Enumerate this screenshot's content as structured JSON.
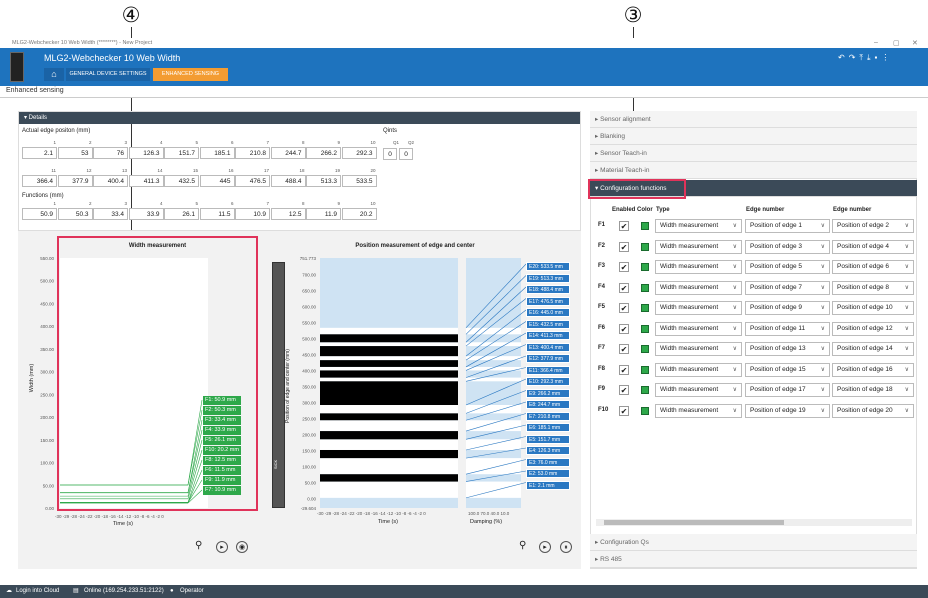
{
  "callouts": {
    "left": "④",
    "right": "③"
  },
  "window": {
    "title": "MLG2-Webchecker 10 Web Width (********) - New Project",
    "controls": [
      "–",
      "▢",
      "✕"
    ]
  },
  "app": {
    "title": "MLG2-Webchecker 10 Web Width",
    "tab_general": "GENERAL DEVICE SETTINGS",
    "tab_enhanced": "ENHANCED SENSING",
    "home_icon": "home-icon",
    "right_icons": [
      "undo-icon",
      "redo-icon",
      "upload-icon",
      "download-icon",
      "save-icon",
      "menu-icon"
    ]
  },
  "breadcrumb": "Enhanced sensing",
  "details": {
    "header": "▾ Details",
    "actual_label": "Actual edge positon (mm)",
    "row1_idx": [
      "1",
      "2",
      "3",
      "4",
      "5",
      "6",
      "7",
      "8",
      "9",
      "10"
    ],
    "row1": [
      "2.1",
      "53",
      "76",
      "126.3",
      "151.7",
      "185.1",
      "210.8",
      "244.7",
      "266.2",
      "292.3"
    ],
    "row2_idx": [
      "11",
      "12",
      "13",
      "14",
      "15",
      "16",
      "17",
      "18",
      "19",
      "20"
    ],
    "row2": [
      "366.4",
      "377.9",
      "400.4",
      "411.3",
      "432.5",
      "445",
      "476.5",
      "488.4",
      "513.3",
      "533.5"
    ],
    "qints_label": "Qints",
    "q_idx": [
      "Q1",
      "Q2"
    ],
    "q_vals": [
      "0",
      "0"
    ],
    "functions_label": "Functions (mm)",
    "func_idx": [
      "1",
      "2",
      "3",
      "4",
      "5",
      "6",
      "7",
      "8",
      "9",
      "10"
    ],
    "func_vals": [
      "50.9",
      "50.3",
      "33.4",
      "33.9",
      "26.1",
      "11.5",
      "10.9",
      "12.5",
      "11.9",
      "20.2"
    ]
  },
  "chart_width": {
    "title": "Width measurement",
    "ylabel": "Width (mm)",
    "xlabel": "Time (s)",
    "yticks": [
      "550.00",
      "500.00",
      "450.00",
      "400.00",
      "350.00",
      "300.00",
      "250.00",
      "200.00",
      "150.00",
      "100.00",
      "50.00",
      "0.00"
    ],
    "xticks": "-30 -29 -28 -24 -22 -20 -18 -16 -14 -12 -10 -8 -6 -4 -2 0",
    "labels": [
      "F1: 50.9 mm",
      "F2: 50.3 mm",
      "F3: 33.4 mm",
      "F4: 33.9 mm",
      "F5: 26.1 mm",
      "F10: 20.2 mm",
      "F8: 12.5 mm",
      "F6: 11.5 mm",
      "F9: 11.9 mm",
      "F7: 10.9 mm"
    ]
  },
  "chart_pos": {
    "title": "Position measurement of edge and center",
    "ylabel": "Position of edge and center (mm)",
    "xlabel": "Time (s)",
    "xlabel2": "Damping (%)",
    "yticks": [
      "751.773",
      "700.00",
      "650.00",
      "600.00",
      "550.00",
      "500.00",
      "450.00",
      "400.00",
      "350.00",
      "300.00",
      "250.00",
      "200.00",
      "150.00",
      "100.00",
      "50.00",
      "0.00",
      "-29.604"
    ],
    "xticks": "-30 -29 -28 -24 -22 -20 -18 -16 -14 -12 -10 -8 -6 -4 -2 0",
    "dticks": "100.0 70.0 40.0 10.0",
    "sensor_label": "SICK",
    "labels": [
      "E20: 533.5 mm",
      "E19: 513.3 mm",
      "E18: 488.4 mm",
      "E17: 476.5 mm",
      "E16: 445.0 mm",
      "E15: 432.5 mm",
      "E14: 411.3 mm",
      "E13: 400.4 mm",
      "E12: 377.9 mm",
      "E11: 366.4 mm",
      "E10: 292.3 mm",
      "E9: 266.2 mm",
      "E8: 244.7 mm",
      "E7: 210.8 mm",
      "E6: 185.1 mm",
      "E5: 151.7 mm",
      "E4: 126.3 mm",
      "E3: 76.0 mm",
      "E2: 53.0 mm",
      "E1: 2.1 mm"
    ]
  },
  "accordion": {
    "sensor_alignment": "▸ Sensor alignment",
    "blanking": "▸ Blanking",
    "sensor_teach": "▸ Sensor Teach-in",
    "material_teach": "▸ Material Teach-in",
    "config": "▾ Configuration functions",
    "config_qs": "▸ Configuration Qs",
    "rs485": "▸ RS 485"
  },
  "config": {
    "headers": {
      "enabled": "Enabled",
      "color": "Color",
      "type": "Type",
      "edge1": "Edge number",
      "edge2": "Edge number"
    },
    "rows": [
      {
        "id": "F1",
        "type": "Width measurement",
        "e1": "Position of edge 1",
        "e2": "Position of edge 2"
      },
      {
        "id": "F2",
        "type": "Width measurement",
        "e1": "Position of edge 3",
        "e2": "Position of edge 4"
      },
      {
        "id": "F3",
        "type": "Width measurement",
        "e1": "Position of edge 5",
        "e2": "Position of edge 6"
      },
      {
        "id": "F4",
        "type": "Width measurement",
        "e1": "Position of edge 7",
        "e2": "Position of edge 8"
      },
      {
        "id": "F5",
        "type": "Width measurement",
        "e1": "Position of edge 9",
        "e2": "Position of edge 10"
      },
      {
        "id": "F6",
        "type": "Width measurement",
        "e1": "Position of edge 11",
        "e2": "Position of edge 12"
      },
      {
        "id": "F7",
        "type": "Width measurement",
        "e1": "Position of edge 13",
        "e2": "Position of edge 14"
      },
      {
        "id": "F8",
        "type": "Width measurement",
        "e1": "Position of edge 15",
        "e2": "Position of edge 16"
      },
      {
        "id": "F9",
        "type": "Width measurement",
        "e1": "Position of edge 17",
        "e2": "Position of edge 18"
      },
      {
        "id": "F10",
        "type": "Width measurement",
        "e1": "Position of edge 19",
        "e2": "Position of edge 20"
      }
    ]
  },
  "footer": {
    "cloud": "Login into Cloud",
    "online": "Online (169.254.233.51:2122)",
    "user": "Operator"
  },
  "colors": {
    "header": "#1e73be",
    "tab_active": "#f39c32",
    "panel": "#3b4a58",
    "green": "#2ea84a",
    "blue": "#2a78c2",
    "highlight": "#e0335a"
  }
}
